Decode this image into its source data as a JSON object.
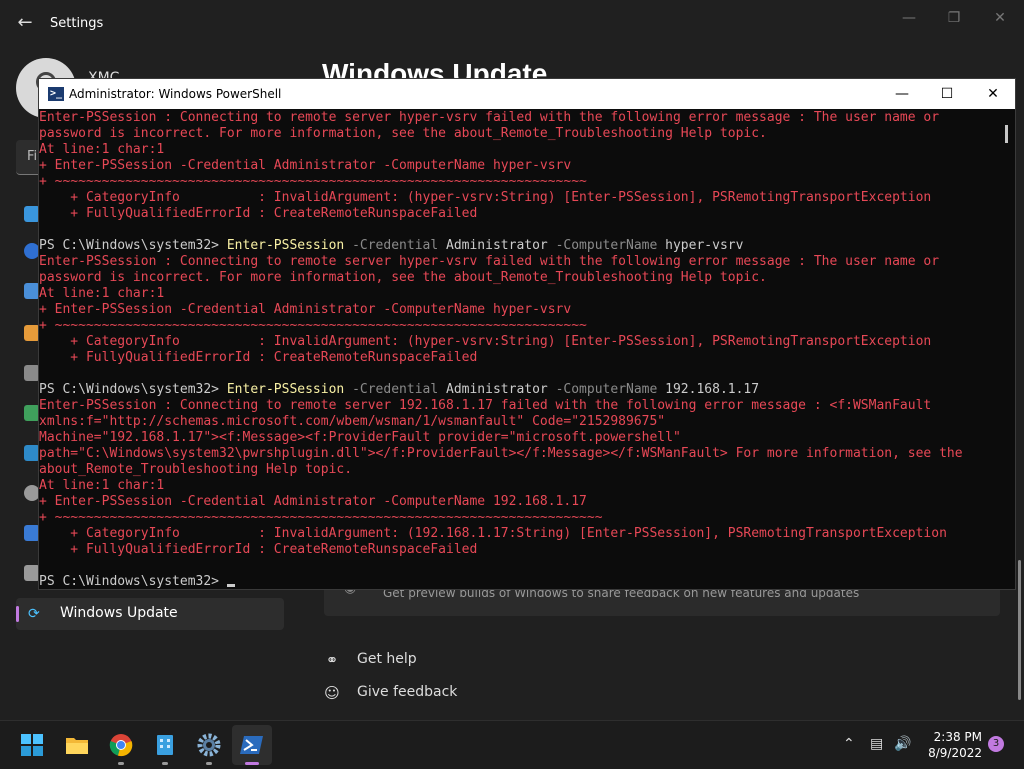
{
  "settings": {
    "title": "Settings",
    "user_name": "XMC",
    "page_heading": "Windows Update",
    "find_placeholder": "Fi",
    "nav_active_label": "Windows Update",
    "insider_card_text": "Get preview builds of Windows to share feedback on new features and updates",
    "get_help": "Get help",
    "give_feedback": "Give feedback"
  },
  "powershell": {
    "title": "Administrator: Windows PowerShell",
    "lines": [
      {
        "t": "err",
        "text": "Enter-PSSession : Connecting to remote server hyper-vsrv failed with the following error message : The user name or"
      },
      {
        "t": "err",
        "text": "password is incorrect. For more information, see the about_Remote_Troubleshooting Help topic."
      },
      {
        "t": "err",
        "text": "At line:1 char:1"
      },
      {
        "t": "err",
        "text": "+ Enter-PSSession -Credential Administrator -ComputerName hyper-vsrv"
      },
      {
        "t": "err",
        "text": "+ ~~~~~~~~~~~~~~~~~~~~~~~~~~~~~~~~~~~~~~~~~~~~~~~~~~~~~~~~~~~~~~~~~~~~"
      },
      {
        "t": "err",
        "text": "    + CategoryInfo          : InvalidArgument: (hyper-vsrv:String) [Enter-PSSession], PSRemotingTransportException"
      },
      {
        "t": "err",
        "text": "    + FullyQualifiedErrorId : CreateRemoteRunspaceFailed"
      },
      {
        "t": "blank",
        "text": ""
      },
      {
        "t": "cmd",
        "prompt": "PS C:\\Windows\\system32> ",
        "cmd": "Enter-PSSession",
        "p1": " -Credential ",
        "a1": "Administrator",
        "p2": " -ComputerName ",
        "a2": "hyper-vsrv"
      },
      {
        "t": "err",
        "text": "Enter-PSSession : Connecting to remote server hyper-vsrv failed with the following error message : The user name or"
      },
      {
        "t": "err",
        "text": "password is incorrect. For more information, see the about_Remote_Troubleshooting Help topic."
      },
      {
        "t": "err",
        "text": "At line:1 char:1"
      },
      {
        "t": "err",
        "text": "+ Enter-PSSession -Credential Administrator -ComputerName hyper-vsrv"
      },
      {
        "t": "err",
        "text": "+ ~~~~~~~~~~~~~~~~~~~~~~~~~~~~~~~~~~~~~~~~~~~~~~~~~~~~~~~~~~~~~~~~~~~~"
      },
      {
        "t": "err",
        "text": "    + CategoryInfo          : InvalidArgument: (hyper-vsrv:String) [Enter-PSSession], PSRemotingTransportException"
      },
      {
        "t": "err",
        "text": "    + FullyQualifiedErrorId : CreateRemoteRunspaceFailed"
      },
      {
        "t": "blank",
        "text": ""
      },
      {
        "t": "cmd",
        "prompt": "PS C:\\Windows\\system32> ",
        "cmd": "Enter-PSSession",
        "p1": " -Credential ",
        "a1": "Administrator",
        "p2": " -ComputerName ",
        "a2": "192.168.1.17"
      },
      {
        "t": "err",
        "text": "Enter-PSSession : Connecting to remote server 192.168.1.17 failed with the following error message : <f:WSManFault"
      },
      {
        "t": "err",
        "text": "xmlns:f=\"http://schemas.microsoft.com/wbem/wsman/1/wsmanfault\" Code=\"2152989675\""
      },
      {
        "t": "err",
        "text": "Machine=\"192.168.1.17\"><f:Message><f:ProviderFault provider=\"microsoft.powershell\""
      },
      {
        "t": "err",
        "text": "path=\"C:\\Windows\\system32\\pwrshplugin.dll\"></f:ProviderFault></f:Message></f:WSManFault> For more information, see the"
      },
      {
        "t": "err",
        "text": "about_Remote_Troubleshooting Help topic."
      },
      {
        "t": "err",
        "text": "At line:1 char:1"
      },
      {
        "t": "err",
        "text": "+ Enter-PSSession -Credential Administrator -ComputerName 192.168.1.17"
      },
      {
        "t": "err",
        "text": "+ ~~~~~~~~~~~~~~~~~~~~~~~~~~~~~~~~~~~~~~~~~~~~~~~~~~~~~~~~~~~~~~~~~~~~~~"
      },
      {
        "t": "err",
        "text": "    + CategoryInfo          : InvalidArgument: (192.168.1.17:String) [Enter-PSSession], PSRemotingTransportException"
      },
      {
        "t": "err",
        "text": "    + FullyQualifiedErrorId : CreateRemoteRunspaceFailed"
      },
      {
        "t": "blank",
        "text": ""
      },
      {
        "t": "prompt",
        "text": "PS C:\\Windows\\system32> "
      }
    ]
  },
  "taskbar": {
    "apps": [
      "start-icon",
      "file-explorer-icon",
      "chrome-icon",
      "app-icon",
      "settings-icon",
      "powershell-icon"
    ],
    "time": "2:38 PM",
    "date": "8/9/2022",
    "notification_count": "3"
  },
  "colors": {
    "error_red": "#e74856",
    "command_yellow": "#f9f1a5",
    "accent_purple": "#c17ae0"
  }
}
